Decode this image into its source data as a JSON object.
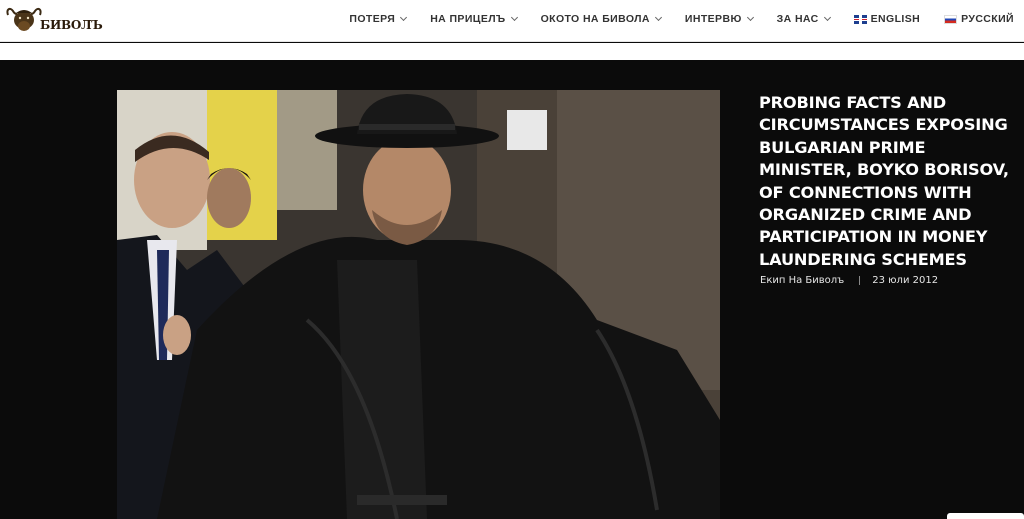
{
  "site": {
    "logo_text": "БИВОЛЪ"
  },
  "nav": {
    "items": [
      {
        "label": "ПОТЕРЯ",
        "has_dropdown": true
      },
      {
        "label": "НА ПРИЦЕЛЪ",
        "has_dropdown": true
      },
      {
        "label": "ОКОТО НА БИВОЛА",
        "has_dropdown": true
      },
      {
        "label": "ИНТЕРВЮ",
        "has_dropdown": true
      },
      {
        "label": "ЗА НАС",
        "has_dropdown": true
      }
    ],
    "languages": [
      {
        "label": "ENGLISH",
        "flag": "uk-flag-icon"
      },
      {
        "label": "РУССКИЙ",
        "flag": "russia-flag-icon"
      }
    ]
  },
  "article": {
    "title": "PROBING FACTS AND CIRCUMSTANCES EXPOSING BULGARIAN PRIME MINISTER, BOYKO BORISOV, OF CONNECTIONS WITH ORGANIZED CRIME AND PARTICIPATION IN MONEY LAUNDERING SCHEMES",
    "author": "Екип На Биволъ",
    "date": "23 юли 2012"
  },
  "colors": {
    "background": "#0b0b0b",
    "header": "#ffffff",
    "title": "#ffffff"
  }
}
